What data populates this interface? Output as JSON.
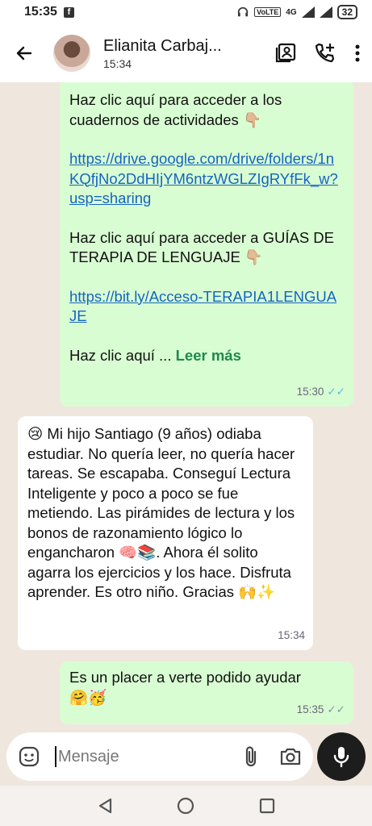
{
  "status_bar": {
    "time": "15:35",
    "network": "4G",
    "volte": "VoLTE",
    "battery": "32"
  },
  "header": {
    "contact_name": "Elianita Carbaj...",
    "last_seen": "15:34"
  },
  "messages": [
    {
      "type": "outgoing",
      "paragraphs": [
        {
          "text": "Haz clic aquí para acceder a los cuadernos de actividades 👇🏼"
        },
        {
          "link": "https://drive.google.com/drive/folders/1nKQfjNo2DdHIjYM6ntzWGLZIgRYfFk_w?usp=sharing"
        },
        {
          "text": "Haz clic aquí para acceder a GUÍAS DE TERAPIA DE LENGUAJE 👇🏼"
        },
        {
          "link": "https://bit.ly/Acceso-TERAPIA1LENGUAJE"
        }
      ],
      "truncated_text": "Haz clic aquí ...",
      "read_more": "Leer más",
      "time": "15:30",
      "ticks": "✓✓"
    },
    {
      "type": "incoming",
      "text": "😢 Mi hijo Santiago (9 años) odiaba estudiar. No quería leer, no quería hacer tareas. Se escapaba. Conseguí Lectura Inteligente y poco a poco se fue metiendo. Las pirámides de lectura y los bonos de razonamiento lógico lo engancharon 🧠📚. Ahora él solito agarra los ejercicios y los hace. Disfruta aprender. Es otro niño. Gracias 🙌✨",
      "time": "15:34"
    },
    {
      "type": "outgoing",
      "text": "Es un placer a verte podido ayudar 🤗🥳",
      "time": "15:35",
      "ticks": "✓✓"
    }
  ],
  "composer": {
    "placeholder": "Mensaje"
  },
  "colors": {
    "outgoing_bubble": "#d9fdd3",
    "incoming_bubble": "#ffffff",
    "chat_background": "#efe7de",
    "link": "#1565c0",
    "read_more": "#1e8a4c",
    "read_ticks": "#53bdeb"
  },
  "icons": {
    "back": "arrow-left-icon",
    "contact_card": "contact-card-icon",
    "add_call": "add-call-icon",
    "menu": "more-vert-icon",
    "sticker": "sticker-icon",
    "attach": "paperclip-icon",
    "camera": "camera-icon",
    "mic": "mic-icon",
    "nav_back": "triangle-back-icon",
    "nav_home": "circle-home-icon",
    "nav_recents": "square-recents-icon"
  }
}
